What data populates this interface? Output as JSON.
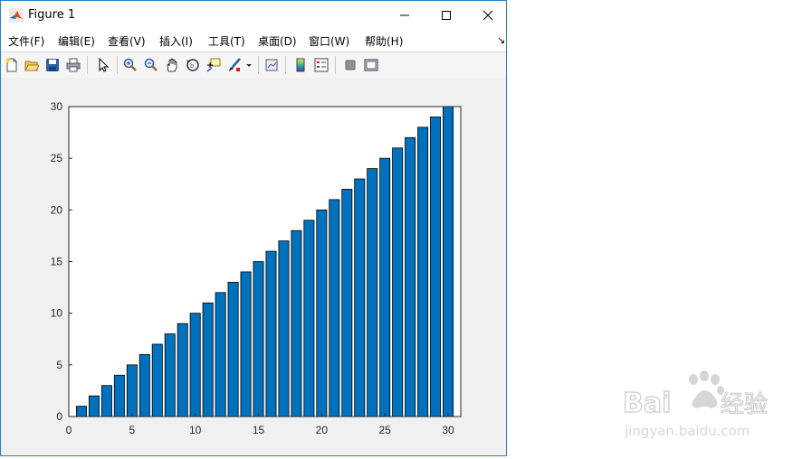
{
  "window": {
    "title": "Figure 1"
  },
  "menu": [
    "文件(F)",
    "编辑(E)",
    "查看(V)",
    "插入(I)",
    "工具(T)",
    "桌面(D)",
    "窗口(W)",
    "帮助(H)"
  ],
  "menu_more_glyph": "↘",
  "toolbar": [
    "new-figure-icon",
    "open-file-icon",
    "save-icon",
    "print-icon",
    "select-arrow-icon",
    "zoom-in-icon",
    "zoom-out-icon",
    "pan-hand-icon",
    "rotate-3d-icon",
    "data-cursor-icon",
    "brush-icon",
    "link-plot-icon",
    "colorbar-icon",
    "legend-icon",
    "hide-plot-tools-icon",
    "show-plot-tools-icon"
  ],
  "chart_data": {
    "type": "bar",
    "title": "",
    "xlabel": "",
    "ylabel": "",
    "x": [
      1,
      2,
      3,
      4,
      5,
      6,
      7,
      8,
      9,
      10,
      11,
      12,
      13,
      14,
      15,
      16,
      17,
      18,
      19,
      20,
      21,
      22,
      23,
      24,
      25,
      26,
      27,
      28,
      29,
      30
    ],
    "values": [
      1,
      2,
      3,
      4,
      5,
      6,
      7,
      8,
      9,
      10,
      11,
      12,
      13,
      14,
      15,
      16,
      17,
      18,
      19,
      20,
      21,
      22,
      23,
      24,
      25,
      26,
      27,
      28,
      29,
      30
    ],
    "xlim": [
      0,
      31
    ],
    "ylim": [
      0,
      30
    ],
    "xticks": [
      0,
      5,
      10,
      15,
      20,
      25,
      30
    ],
    "yticks": [
      0,
      5,
      10,
      15,
      20,
      25,
      30
    ],
    "bar_color": "#0072bd",
    "edge_color": "#000000",
    "grid": false
  },
  "watermark": {
    "brand": "Baidu",
    "cn": "经验",
    "url": "jingyan.baidu.com"
  }
}
